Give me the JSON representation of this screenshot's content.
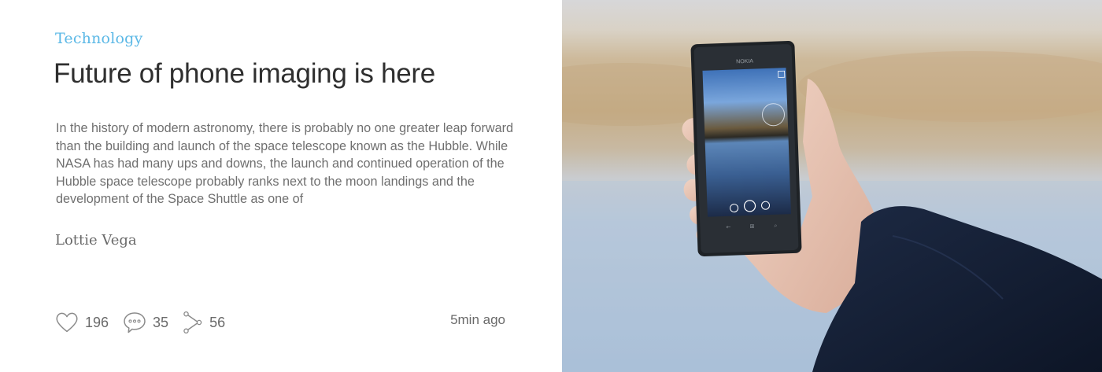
{
  "article": {
    "category": "Technology",
    "title": "Future of phone imaging is here",
    "excerpt": "In the history of modern astronomy, there is probably no one greater leap forward than the building and launch of the space telescope known as the Hubble. While NASA has had many ups and downs, the launch and continued operation of the Hubble space telescope probably ranks next to the moon landings and the development of the Space Shuttle as one of",
    "author": "Lottie Vega",
    "time": "5min ago"
  },
  "stats": {
    "likes": "196",
    "comments": "35",
    "shares": "56"
  },
  "icons": {
    "like": "heart-icon",
    "comment": "speech-bubble-icon",
    "share": "share-icon"
  },
  "photo": {
    "phone_brand": "NOKIA"
  },
  "colors": {
    "accent": "#5bb8e6",
    "title": "#2f2f2f",
    "body": "#6f6f6f"
  }
}
